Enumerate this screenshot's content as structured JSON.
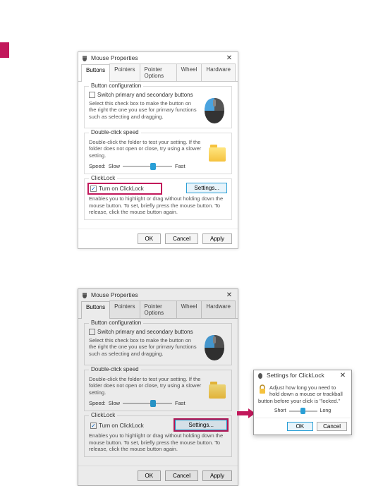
{
  "dialog": {
    "title": "Mouse Properties",
    "tabs": [
      "Buttons",
      "Pointers",
      "Pointer Options",
      "Wheel",
      "Hardware"
    ],
    "buttonConfig": {
      "legend": "Button configuration",
      "switchLabel": "Switch primary and secondary buttons",
      "desc": "Select this check box to make the button on the right the one you use for primary functions such as selecting and dragging."
    },
    "doubleClick": {
      "legend": "Double-click speed",
      "desc": "Double-click the folder to test your setting. If the folder does not open or close, try using a slower setting.",
      "speedLabel": "Speed:",
      "slow": "Slow",
      "fast": "Fast"
    },
    "clickLock": {
      "legend": "ClickLock",
      "turnOn": "Turn on ClickLock",
      "settingsBtn": "Settings...",
      "desc": "Enables you to highlight or drag without holding down the mouse button. To set, briefly press the mouse button. To release, click the mouse button again."
    },
    "buttons": {
      "ok": "OK",
      "cancel": "Cancel",
      "apply": "Apply"
    }
  },
  "popup": {
    "title": "Settings for ClickLock",
    "desc": "Adjust how long you need to hold down a mouse or trackball button before your click is \"locked.\"",
    "short": "Short",
    "long": "Long",
    "ok": "OK",
    "cancel": "Cancel"
  }
}
